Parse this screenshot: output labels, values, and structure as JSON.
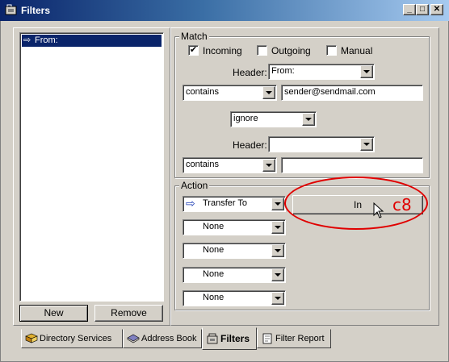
{
  "window": {
    "title": "Filters",
    "controls": {
      "minimize": "_",
      "maximize": "□",
      "close": "✕"
    }
  },
  "filter_list": {
    "items": [
      {
        "label": "From:"
      }
    ],
    "new_button": "New",
    "remove_button": "Remove"
  },
  "match": {
    "group_label": "Match",
    "checkboxes": [
      {
        "label": "Incoming",
        "checked": true
      },
      {
        "label": "Outgoing",
        "checked": false
      },
      {
        "label": "Manual",
        "checked": false
      }
    ],
    "header1_label": "Header:",
    "header1_value": "From:",
    "condition1": "contains",
    "value1": "sender@sendmail.com",
    "logic": "ignore",
    "header2_label": "Header:",
    "header2_value": "",
    "condition2": "contains",
    "value2": ""
  },
  "action": {
    "group_label": "Action",
    "actions": [
      "Transfer To",
      "None",
      "None",
      "None",
      "None"
    ],
    "target_button": "In"
  },
  "annotation": {
    "text": "c8",
    "color": "#e00000"
  },
  "tabs": [
    {
      "label": "Directory Services",
      "icon": "directory-services-icon",
      "active": false
    },
    {
      "label": "Address Book",
      "icon": "address-book-icon",
      "active": false
    },
    {
      "label": "Filters",
      "icon": "filters-icon",
      "active": true
    },
    {
      "label": "Filter Report",
      "icon": "filter-report-icon",
      "active": false
    }
  ],
  "colors": {
    "titlebar_start": "#0a246a",
    "titlebar_end": "#a6caf0",
    "face": "#d4d0c8",
    "selection": "#0a246a",
    "arrow": "#1c3cb4"
  }
}
